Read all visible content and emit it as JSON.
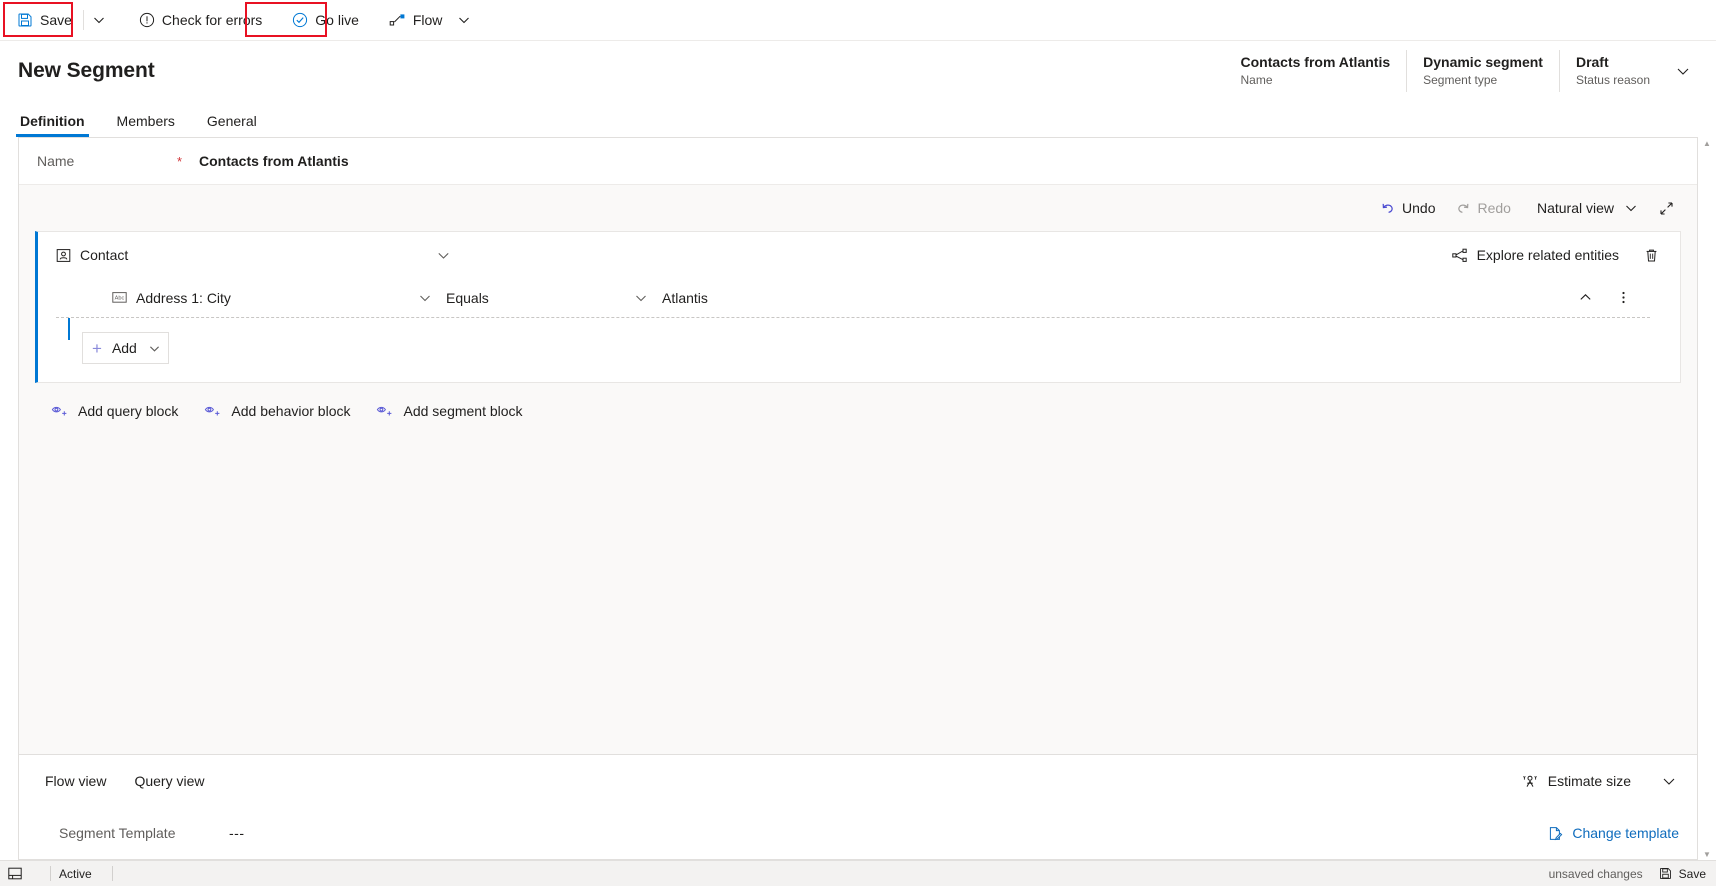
{
  "commandbar": {
    "save_label": "Save",
    "save_caret": "chevron-down",
    "check_errors_label": "Check for errors",
    "go_live_label": "Go live",
    "flow_label": "Flow",
    "flow_caret": "chevron-down",
    "highlight_color": "#e81123"
  },
  "header": {
    "title": "New Segment",
    "fields": [
      {
        "value": "Contacts from Atlantis",
        "label": "Name"
      },
      {
        "value": "Dynamic segment",
        "label": "Segment type"
      },
      {
        "value": "Draft",
        "label": "Status reason"
      }
    ]
  },
  "tabs": [
    {
      "label": "Definition",
      "active": true
    },
    {
      "label": "Members",
      "active": false
    },
    {
      "label": "General",
      "active": false
    }
  ],
  "name_row": {
    "label": "Name",
    "required_mark": "*",
    "value": "Contacts from Atlantis"
  },
  "query_toolbar": {
    "undo_label": "Undo",
    "redo_label": "Redo",
    "view_mode_label": "Natural view",
    "view_mode_caret": "chevron-down",
    "expand_icon": "expand-icon"
  },
  "query_block": {
    "entity_label": "Contact",
    "entity_icon": "contact-entity-icon",
    "collapse_icon": "chevron-down-icon",
    "explore_label": "Explore related entities",
    "explore_icon": "share-nodes-icon",
    "delete_icon": "trash-icon",
    "condition": {
      "field_label": "Address 1: City",
      "field_icon": "text-field-icon",
      "operator_label": "Equals",
      "value_label": "Atlantis",
      "collapse_icon": "chevron-up-icon",
      "more_icon": "more-vertical-icon"
    },
    "add_button_label": "Add",
    "add_button_caret": "chevron-down"
  },
  "block_links": [
    {
      "label": "Add query block",
      "icon": "add-query-block-icon"
    },
    {
      "label": "Add behavior block",
      "icon": "add-behavior-block-icon"
    },
    {
      "label": "Add segment block",
      "icon": "add-segment-block-icon"
    }
  ],
  "footer": {
    "flow_view_label": "Flow view",
    "query_view_label": "Query view",
    "estimate_label": "Estimate size",
    "estimate_icon": "people-icon",
    "estimate_caret": "chevron-down",
    "segment_template_label": "Segment Template",
    "segment_template_value": "---",
    "change_template_label": "Change template",
    "change_template_icon": "document-edit-icon"
  },
  "statusbar": {
    "left_icon": "form-icon",
    "state_label": "Active",
    "unsaved_label": "unsaved changes",
    "save_label": "Save",
    "save_icon": "save-icon"
  },
  "colors": {
    "accent": "#0078d4",
    "link": "#0f6cbd",
    "highlight": "#e81123",
    "required": "#d13438",
    "muted": "#605e5c"
  }
}
